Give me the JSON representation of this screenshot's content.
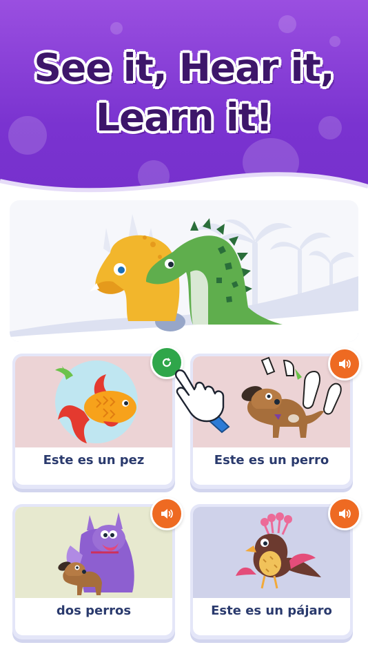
{
  "header": {
    "headline_line1": "See it, Hear it,",
    "headline_line2": "Learn it!"
  },
  "scene": {
    "description_icons": [
      "triceratops-icon",
      "dinosaur-icon",
      "palm-tree-icon"
    ]
  },
  "cards": [
    {
      "label": "Este es un pez",
      "action_icon": "replay-icon",
      "action_color": "#2fa64a",
      "image_icon": "goldfish-icon"
    },
    {
      "label": "Este es un perro",
      "action_icon": "speaker-icon",
      "action_color": "#ee6a22",
      "image_icon": "dog-icon"
    },
    {
      "label": "dos perros",
      "action_icon": "speaker-icon",
      "action_color": "#ee6a22",
      "image_icon": "two-dogs-icon"
    },
    {
      "label": "Este es un pájaro",
      "action_icon": "speaker-icon",
      "action_color": "#ee6a22",
      "image_icon": "bird-icon"
    }
  ],
  "colors": {
    "header_purple": "#7a33d0",
    "headline_text": "#3d166a",
    "label_text": "#2a3a6d",
    "replay_green": "#2fa64a",
    "speaker_orange": "#ee6a22"
  }
}
